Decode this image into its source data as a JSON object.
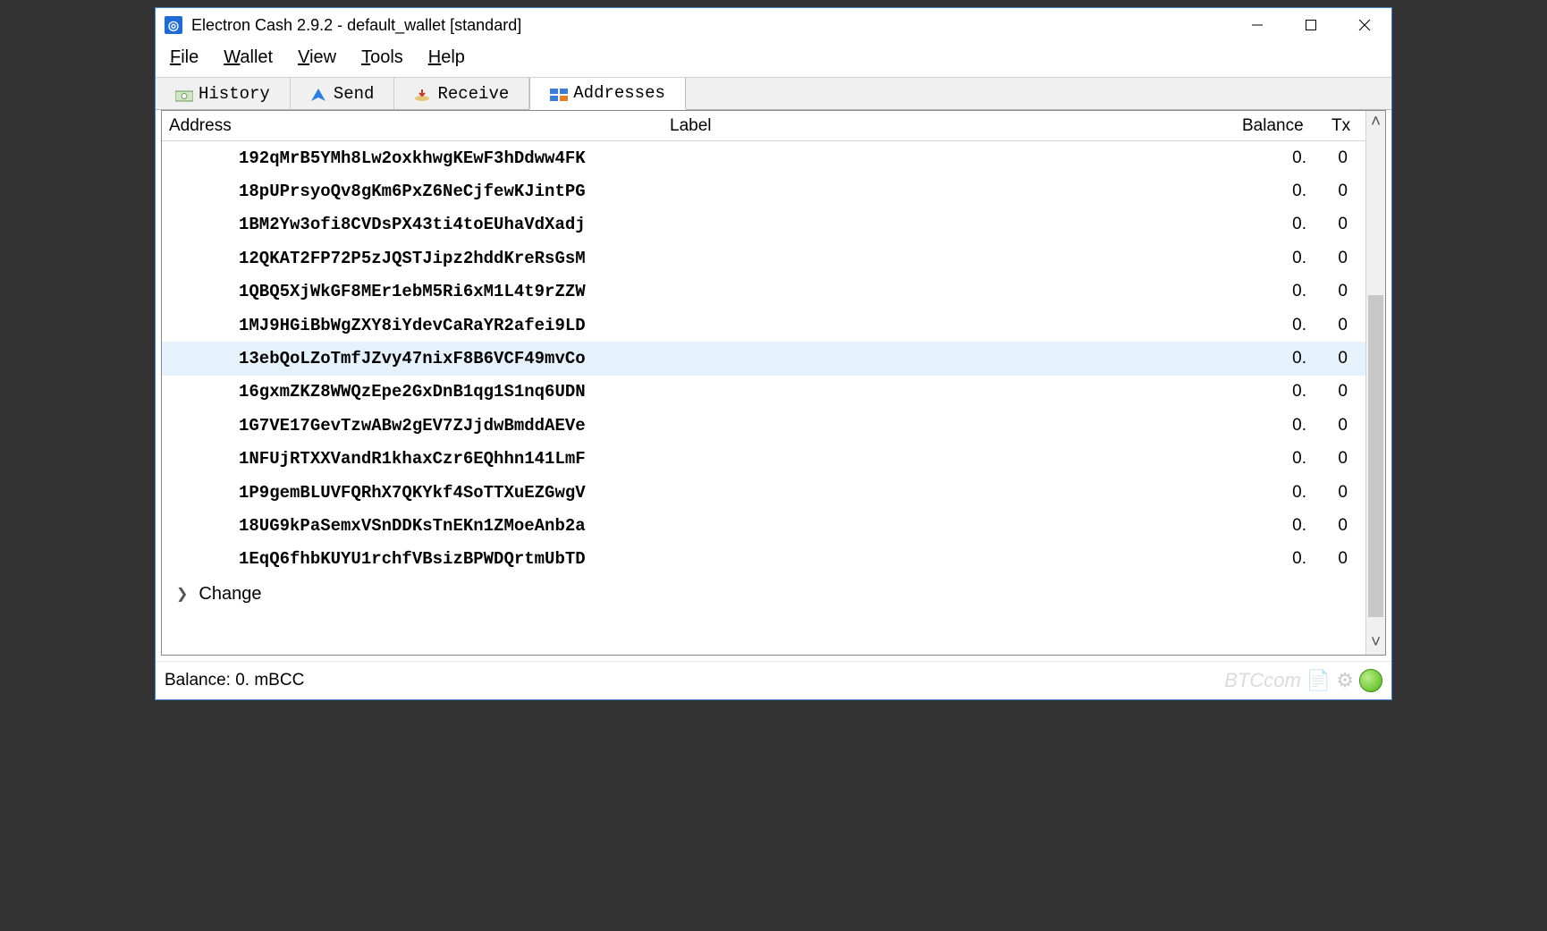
{
  "window": {
    "title": "Electron Cash 2.9.2  -  default_wallet  [standard]"
  },
  "menu": {
    "file": "File",
    "wallet": "Wallet",
    "view": "View",
    "tools": "Tools",
    "help": "Help"
  },
  "tabs": {
    "history": "History",
    "send": "Send",
    "receive": "Receive",
    "addresses": "Addresses"
  },
  "columns": {
    "address": "Address",
    "label": "Label",
    "balance": "Balance",
    "tx": "Tx"
  },
  "rows": [
    {
      "address": "192qMrB5YMh8Lw2oxkhwgKEwF3hDdww4FK",
      "label": "",
      "balance": "0.",
      "tx": "0",
      "selected": false
    },
    {
      "address": "18pUPrsyoQv8gKm6PxZ6NeCjfewKJintPG",
      "label": "",
      "balance": "0.",
      "tx": "0",
      "selected": false
    },
    {
      "address": "1BM2Yw3ofi8CVDsPX43ti4toEUhaVdXadj",
      "label": "",
      "balance": "0.",
      "tx": "0",
      "selected": false
    },
    {
      "address": "12QKAT2FP72P5zJQSTJipz2hddKreRsGsM",
      "label": "",
      "balance": "0.",
      "tx": "0",
      "selected": false
    },
    {
      "address": "1QBQ5XjWkGF8MEr1ebM5Ri6xM1L4t9rZZW",
      "label": "",
      "balance": "0.",
      "tx": "0",
      "selected": false
    },
    {
      "address": "1MJ9HGiBbWgZXY8iYdevCaRaYR2afei9LD",
      "label": "",
      "balance": "0.",
      "tx": "0",
      "selected": false
    },
    {
      "address": "13ebQoLZoTmfJZvy47nixF8B6VCF49mvCo",
      "label": "",
      "balance": "0.",
      "tx": "0",
      "selected": true
    },
    {
      "address": "16gxmZKZ8WWQzEpe2GxDnB1qg1S1nq6UDN",
      "label": "",
      "balance": "0.",
      "tx": "0",
      "selected": false
    },
    {
      "address": "1G7VE17GevTzwABw2gEV7ZJjdwBmddAEVe",
      "label": "",
      "balance": "0.",
      "tx": "0",
      "selected": false
    },
    {
      "address": "1NFUjRTXXVandR1khaxCzr6EQhhn141LmF",
      "label": "",
      "balance": "0.",
      "tx": "0",
      "selected": false
    },
    {
      "address": "1P9gemBLUVFQRhX7QKYkf4SoTTXuEZGwgV",
      "label": "",
      "balance": "0.",
      "tx": "0",
      "selected": false
    },
    {
      "address": "18UG9kPaSemxVSnDDKsTnEKn1ZMoeAnb2a",
      "label": "",
      "balance": "0.",
      "tx": "0",
      "selected": false
    },
    {
      "address": "1EqQ6fhbKUYU1rchfVBsizBPWDQrtmUbTD",
      "label": "",
      "balance": "0.",
      "tx": "0",
      "selected": false
    }
  ],
  "changeGroup": "Change",
  "status": {
    "balance": "Balance: 0. mBCC",
    "watermark": "BTCcom"
  }
}
